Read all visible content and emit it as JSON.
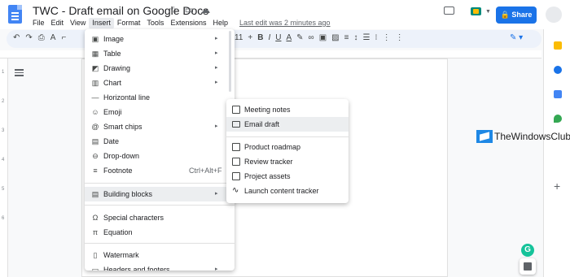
{
  "header": {
    "title": "TWC - Draft email on Google Docs",
    "menus": [
      "File",
      "Edit",
      "View",
      "Insert",
      "Format",
      "Tools",
      "Extensions",
      "Help"
    ],
    "active_menu": "Insert",
    "last_edit": "Last edit was 2 minutes ago",
    "share_label": "Share",
    "share_color": "#1a73e8"
  },
  "toolbar": {
    "font_size": "11",
    "bold": "B",
    "italic": "I",
    "underline": "U",
    "text_color": "A"
  },
  "ruler": {
    "marks": [
      "1",
      "2",
      "3",
      "4",
      "5",
      "6"
    ]
  },
  "insert_menu": {
    "items": [
      {
        "label": "Image",
        "icon": "image-icon",
        "arrow": "▸"
      },
      {
        "label": "Table",
        "icon": "table-icon",
        "arrow": "▸"
      },
      {
        "label": "Drawing",
        "icon": "drawing-icon",
        "arrow": "▸"
      },
      {
        "label": "Chart",
        "icon": "chart-icon",
        "arrow": "▸"
      },
      {
        "label": "Horizontal line",
        "icon": "horizontal-line-icon"
      },
      {
        "label": "Emoji",
        "icon": "emoji-icon"
      },
      {
        "label": "Smart chips",
        "icon": "smart-chips-icon",
        "arrow": "▸"
      },
      {
        "label": "Date",
        "icon": "date-icon"
      },
      {
        "label": "Drop-down",
        "icon": "dropdown-icon"
      },
      {
        "label": "Footnote",
        "icon": "footnote-icon",
        "shortcut": "Ctrl+Alt+F"
      },
      {
        "label": "Building blocks",
        "icon": "building-blocks-icon",
        "arrow": "▸"
      },
      {
        "label": "Special characters",
        "icon": "omega-icon"
      },
      {
        "label": "Equation",
        "icon": "pi-icon"
      },
      {
        "label": "Watermark",
        "icon": "watermark-icon"
      },
      {
        "label": "Headers and footers",
        "icon": "header-icon",
        "arrow": "▸"
      }
    ]
  },
  "building_blocks_submenu": {
    "items": [
      {
        "label": "Meeting notes",
        "icon": "note-icon"
      },
      {
        "label": "Email draft",
        "icon": "mail-icon"
      },
      {
        "label": "Product roadmap",
        "icon": "roadmap-icon"
      },
      {
        "label": "Review tracker",
        "icon": "review-icon"
      },
      {
        "label": "Project assets",
        "icon": "assets-icon"
      },
      {
        "label": "Launch content tracker",
        "icon": "launch-icon"
      }
    ]
  },
  "watermark_text": "TheWindowsClub",
  "grammarly_label": "G"
}
